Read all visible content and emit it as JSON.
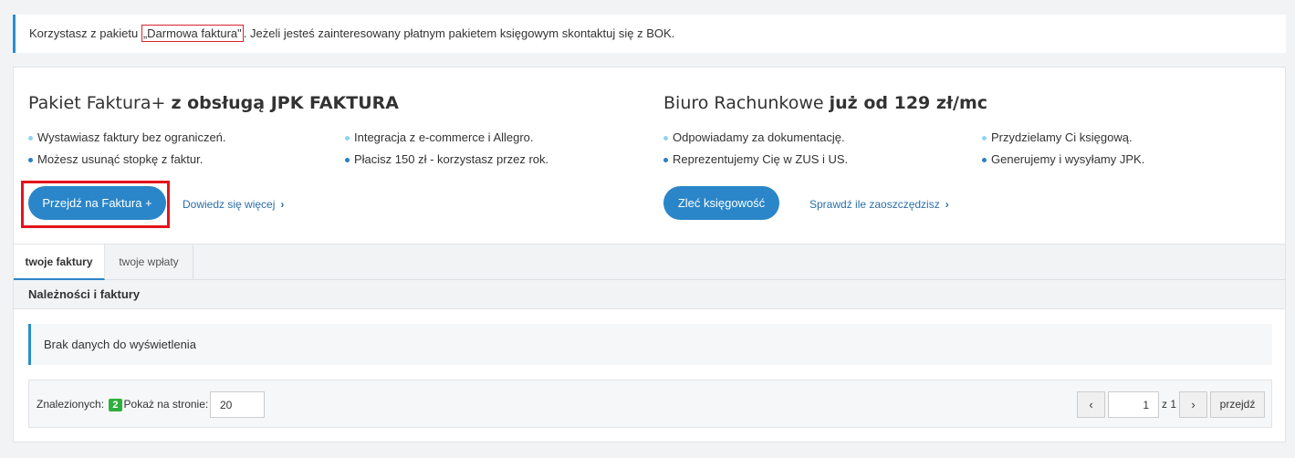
{
  "notice": {
    "before": "Korzystasz z pakietu ",
    "package": "„Darmowa faktura\"",
    "after": ". Jeżeli jesteś zainteresowany płatnym pakietem księgowym skontaktuj się z BOK."
  },
  "left_offer": {
    "title_normal": "Pakiet Faktura+ ",
    "title_bold": "z obsługą JPK FAKTURA",
    "bullets": [
      "Wystawiasz faktury bez ograniczeń.",
      "Integracja z e-commerce i Allegro.",
      "Możesz usunąć stopkę z faktur.",
      "Płacisz 150 zł - korzystasz przez rok."
    ],
    "button_label": "Przejdź na Faktura +",
    "link_label": "Dowiedz się więcej"
  },
  "right_offer": {
    "title_normal": "Biuro Rachunkowe ",
    "title_bold": "już od 129 zł/mc",
    "bullets": [
      "Odpowiadamy za dokumentację.",
      "Przydzielamy Ci księgową.",
      "Reprezentujemy Cię w ZUS i US.",
      "Generujemy i wysyłamy JPK."
    ],
    "button_label": "Zleć księgowość",
    "link_label": "Sprawdź ile zaoszczędzisz"
  },
  "tabs": [
    {
      "label": "twoje faktury",
      "active": true
    },
    {
      "label": "twoje wpłaty",
      "active": false
    }
  ],
  "section_title": "Należności i faktury",
  "empty_message": "Brak danych do wyświetlenia",
  "pagination": {
    "found_label": "Znalezionych:",
    "found_count": "2",
    "per_page_label": "Pokaż na stronie:",
    "per_page_value": "20",
    "prev_icon": "‹",
    "next_icon": "›",
    "current_page": "1",
    "of_total": "z 1",
    "go_label": "przejdź"
  },
  "colors": {
    "accent": "#2a86c8",
    "highlight_red": "#e3141c",
    "badge_green": "#2eaf3d"
  }
}
